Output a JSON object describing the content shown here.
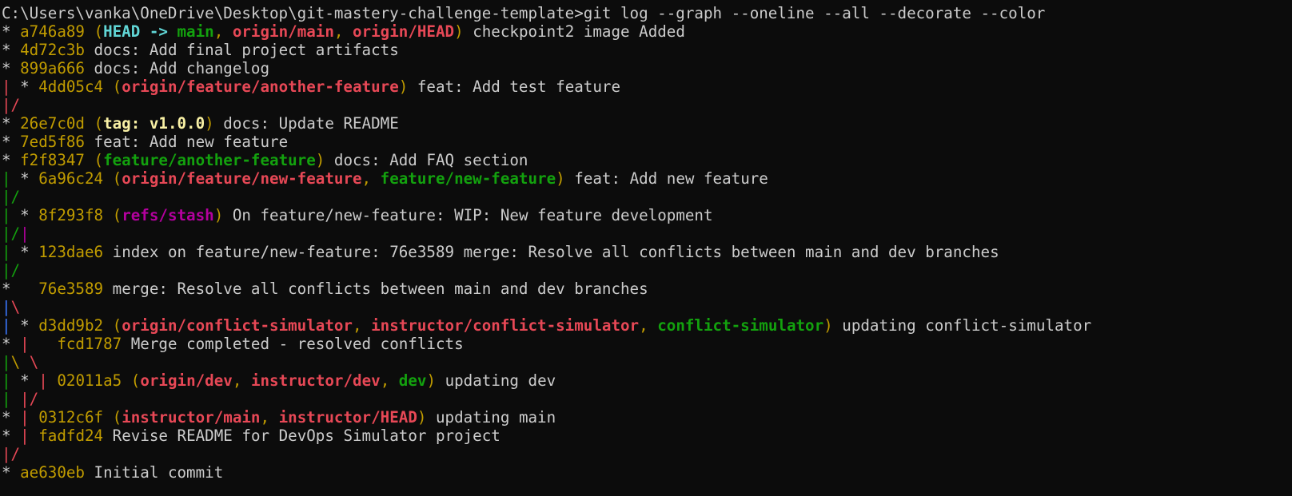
{
  "colors": {
    "background": "#0c0c0c",
    "default": "#cccccc",
    "yellow": "#c19c00",
    "red": "#e74856",
    "green": "#13a10e",
    "cyan": "#61d6d6",
    "magenta": "#b4009e",
    "blue": "#3b78ff",
    "bright_yellow": "#f9f1a5"
  },
  "lines": [
    [
      {
        "t": "C:\\Users\\vanka\\OneDrive\\Desktop\\git-mastery-challenge-template>git log --graph --oneline --all --decorate --color",
        "c": "default"
      }
    ],
    [
      {
        "t": "* ",
        "c": "default"
      },
      {
        "t": "a746a89 (",
        "c": "yellow"
      },
      {
        "t": "HEAD -> ",
        "c": "cyan",
        "b": true
      },
      {
        "t": "main",
        "c": "green",
        "b": true
      },
      {
        "t": ", ",
        "c": "yellow"
      },
      {
        "t": "origin/main",
        "c": "red",
        "b": true
      },
      {
        "t": ", ",
        "c": "yellow"
      },
      {
        "t": "origin/HEAD",
        "c": "red",
        "b": true
      },
      {
        "t": ")",
        "c": "yellow"
      },
      {
        "t": " checkpoint2 image Added",
        "c": "default"
      }
    ],
    [
      {
        "t": "* ",
        "c": "default"
      },
      {
        "t": "4d72c3b",
        "c": "yellow"
      },
      {
        "t": " docs: Add final project artifacts",
        "c": "default"
      }
    ],
    [
      {
        "t": "* ",
        "c": "default"
      },
      {
        "t": "899a666",
        "c": "yellow"
      },
      {
        "t": " docs: Add changelog",
        "c": "default"
      }
    ],
    [
      {
        "t": "|",
        "c": "red"
      },
      {
        "t": " * ",
        "c": "default"
      },
      {
        "t": "4dd05c4 (",
        "c": "yellow"
      },
      {
        "t": "origin/feature/another-feature",
        "c": "red",
        "b": true
      },
      {
        "t": ")",
        "c": "yellow"
      },
      {
        "t": " feat: Add test feature",
        "c": "default"
      }
    ],
    [
      {
        "t": "|/",
        "c": "red"
      }
    ],
    [
      {
        "t": "* ",
        "c": "default"
      },
      {
        "t": "26e7c0d (",
        "c": "yellow"
      },
      {
        "t": "tag: v1.0.0",
        "c": "bright_yellow",
        "b": true
      },
      {
        "t": ")",
        "c": "yellow"
      },
      {
        "t": " docs: Update README",
        "c": "default"
      }
    ],
    [
      {
        "t": "* ",
        "c": "default"
      },
      {
        "t": "7ed5f86",
        "c": "yellow"
      },
      {
        "t": " feat: Add new feature",
        "c": "default"
      }
    ],
    [
      {
        "t": "* ",
        "c": "default"
      },
      {
        "t": "f2f8347 (",
        "c": "yellow"
      },
      {
        "t": "feature/another-feature",
        "c": "green",
        "b": true
      },
      {
        "t": ")",
        "c": "yellow"
      },
      {
        "t": " docs: Add FAQ section",
        "c": "default"
      }
    ],
    [
      {
        "t": "|",
        "c": "green"
      },
      {
        "t": " * ",
        "c": "default"
      },
      {
        "t": "6a96c24 (",
        "c": "yellow"
      },
      {
        "t": "origin/feature/new-feature",
        "c": "red",
        "b": true
      },
      {
        "t": ", ",
        "c": "yellow"
      },
      {
        "t": "feature/new-feature",
        "c": "green",
        "b": true
      },
      {
        "t": ")",
        "c": "yellow"
      },
      {
        "t": " feat: Add new feature",
        "c": "default"
      }
    ],
    [
      {
        "t": "|/",
        "c": "green"
      }
    ],
    [
      {
        "t": "|",
        "c": "green"
      },
      {
        "t": " * ",
        "c": "default"
      },
      {
        "t": "8f293f8 (",
        "c": "yellow"
      },
      {
        "t": "refs/stash",
        "c": "magenta",
        "b": true
      },
      {
        "t": ")",
        "c": "yellow"
      },
      {
        "t": " On feature/new-feature: WIP: New feature development",
        "c": "default"
      }
    ],
    [
      {
        "t": "|/",
        "c": "green"
      },
      {
        "t": "|",
        "c": "magenta"
      }
    ],
    [
      {
        "t": "|",
        "c": "green"
      },
      {
        "t": " * ",
        "c": "default"
      },
      {
        "t": "123dae6",
        "c": "yellow"
      },
      {
        "t": " index on feature/new-feature: 76e3589 merge: Resolve all conflicts between main and dev branches",
        "c": "default"
      }
    ],
    [
      {
        "t": "|/",
        "c": "green"
      }
    ],
    [
      {
        "t": "*   ",
        "c": "default"
      },
      {
        "t": "76e3589",
        "c": "yellow"
      },
      {
        "t": " merge: Resolve all conflicts between main and dev branches",
        "c": "default"
      }
    ],
    [
      {
        "t": "|",
        "c": "blue"
      },
      {
        "t": "\\",
        "c": "red"
      }
    ],
    [
      {
        "t": "|",
        "c": "blue"
      },
      {
        "t": " * ",
        "c": "default"
      },
      {
        "t": "d3dd9b2 (",
        "c": "yellow"
      },
      {
        "t": "origin/conflict-simulator",
        "c": "red",
        "b": true
      },
      {
        "t": ", ",
        "c": "yellow"
      },
      {
        "t": "instructor/conflict-simulator",
        "c": "red",
        "b": true
      },
      {
        "t": ", ",
        "c": "yellow"
      },
      {
        "t": "conflict-simulator",
        "c": "green",
        "b": true
      },
      {
        "t": ")",
        "c": "yellow"
      },
      {
        "t": " updating conflict-simulator",
        "c": "default"
      }
    ],
    [
      {
        "t": "* ",
        "c": "default"
      },
      {
        "t": "|",
        "c": "red"
      },
      {
        "t": "   ",
        "c": "default"
      },
      {
        "t": "fcd1787",
        "c": "yellow"
      },
      {
        "t": " Merge completed - resolved conflicts",
        "c": "default"
      }
    ],
    [
      {
        "t": "|",
        "c": "green"
      },
      {
        "t": "\\",
        "c": "yellow"
      },
      {
        "t": " ",
        "c": "default"
      },
      {
        "t": "\\",
        "c": "red"
      }
    ],
    [
      {
        "t": "|",
        "c": "green"
      },
      {
        "t": " * ",
        "c": "default"
      },
      {
        "t": "|",
        "c": "red"
      },
      {
        "t": " ",
        "c": "default"
      },
      {
        "t": "02011a5 (",
        "c": "yellow"
      },
      {
        "t": "origin/dev",
        "c": "red",
        "b": true
      },
      {
        "t": ", ",
        "c": "yellow"
      },
      {
        "t": "instructor/dev",
        "c": "red",
        "b": true
      },
      {
        "t": ", ",
        "c": "yellow"
      },
      {
        "t": "dev",
        "c": "green",
        "b": true
      },
      {
        "t": ")",
        "c": "yellow"
      },
      {
        "t": " updating dev",
        "c": "default"
      }
    ],
    [
      {
        "t": "|",
        "c": "green"
      },
      {
        "t": " ",
        "c": "default"
      },
      {
        "t": "|/",
        "c": "red"
      }
    ],
    [
      {
        "t": "* ",
        "c": "default"
      },
      {
        "t": "|",
        "c": "red"
      },
      {
        "t": " ",
        "c": "default"
      },
      {
        "t": "0312c6f (",
        "c": "yellow"
      },
      {
        "t": "instructor/main",
        "c": "red",
        "b": true
      },
      {
        "t": ", ",
        "c": "yellow"
      },
      {
        "t": "instructor/HEAD",
        "c": "red",
        "b": true
      },
      {
        "t": ")",
        "c": "yellow"
      },
      {
        "t": " updating main",
        "c": "default"
      }
    ],
    [
      {
        "t": "* ",
        "c": "default"
      },
      {
        "t": "|",
        "c": "red"
      },
      {
        "t": " ",
        "c": "default"
      },
      {
        "t": "fadfd24",
        "c": "yellow"
      },
      {
        "t": " Revise README for DevOps Simulator project",
        "c": "default"
      }
    ],
    [
      {
        "t": "|/",
        "c": "red"
      }
    ],
    [
      {
        "t": "* ",
        "c": "default"
      },
      {
        "t": "ae630eb",
        "c": "yellow"
      },
      {
        "t": " Initial commit",
        "c": "default"
      }
    ]
  ]
}
